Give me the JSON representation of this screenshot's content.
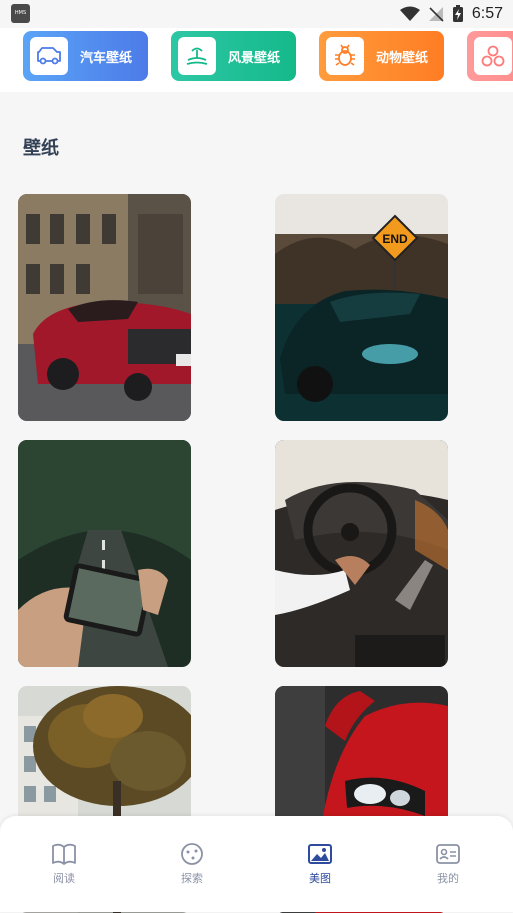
{
  "status": {
    "badge": "HMS",
    "time": "6:57"
  },
  "categories": [
    {
      "label": "汽车壁纸",
      "icon": "car-icon"
    },
    {
      "label": "风景壁纸",
      "icon": "landscape-icon"
    },
    {
      "label": "动物壁纸",
      "icon": "bug-icon"
    },
    {
      "label": "",
      "icon": "circles-icon"
    }
  ],
  "section": {
    "title": "壁纸"
  },
  "wallpapers": [
    {
      "subject": "red sports car on street"
    },
    {
      "subject": "dark green coupe with END road sign"
    },
    {
      "subject": "hand holding phone showing forest road"
    },
    {
      "subject": "driver hand on steering wheel"
    },
    {
      "subject": "autumn tree in front of building"
    },
    {
      "subject": "red car headlight"
    }
  ],
  "nav": [
    {
      "label": "阅读",
      "icon": "book-icon",
      "active": false
    },
    {
      "label": "探索",
      "icon": "compass-icon",
      "active": false
    },
    {
      "label": "美图",
      "icon": "image-icon",
      "active": true
    },
    {
      "label": "我的",
      "icon": "profile-card-icon",
      "active": false
    }
  ],
  "colors": {
    "car_gradient": [
      "#5aa4f7",
      "#4d7be8"
    ],
    "landscape_gradient": [
      "#2ec7a5",
      "#14b98a"
    ],
    "animal_gradient": [
      "#ff9c3c",
      "#ff7d24"
    ],
    "fourth_gradient": [
      "#ff9a9a",
      "#ff7b7b"
    ],
    "nav_active": "#2e4b9e",
    "nav_inactive": "#8b92a6"
  }
}
